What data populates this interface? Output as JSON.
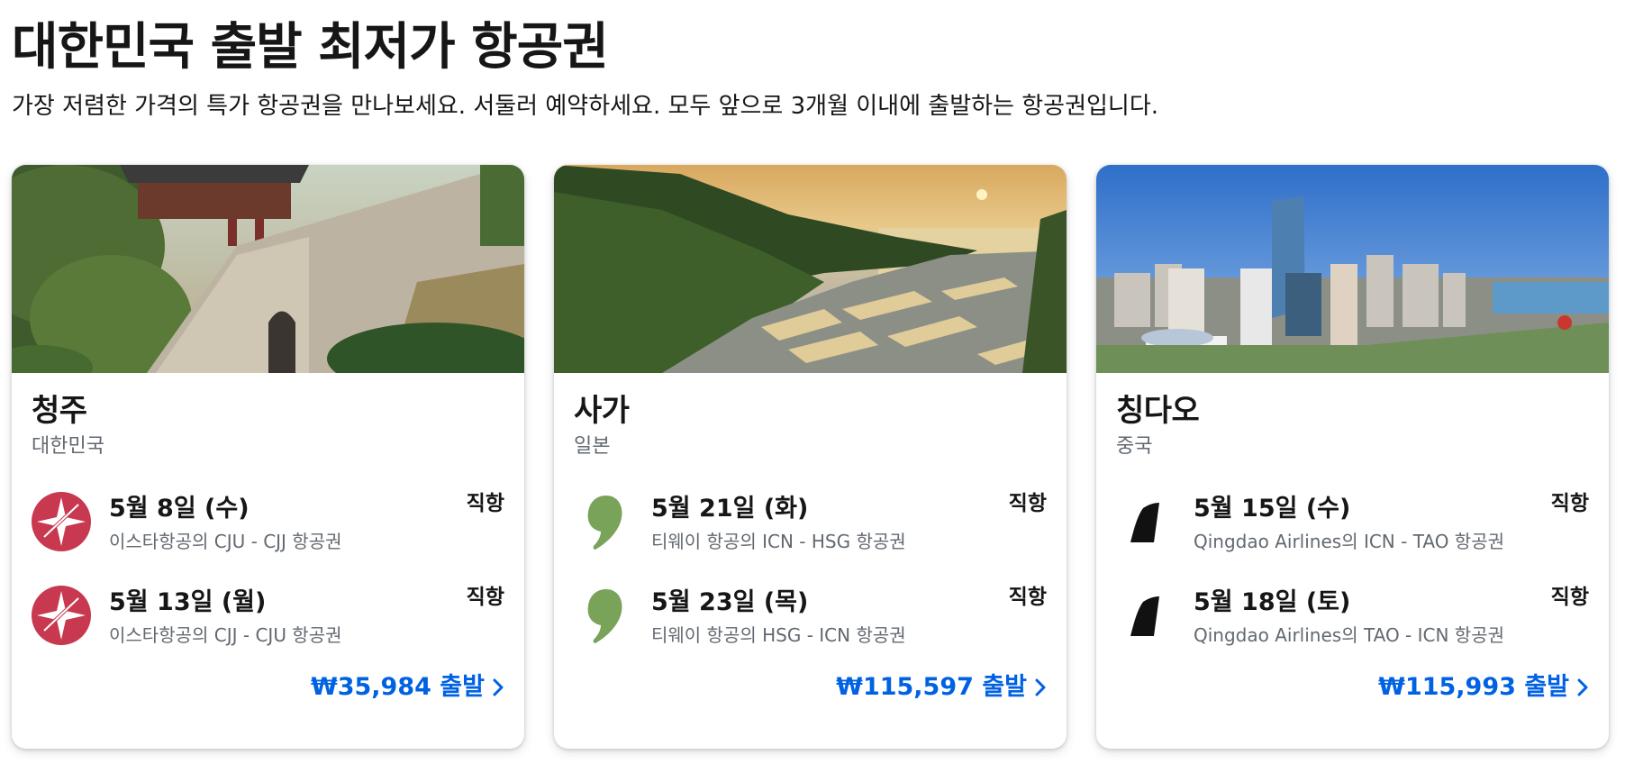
{
  "header": {
    "title": "대한민국 출발 최저가 항공권",
    "subtitle": "가장 저렴한 가격의 특가 항공권을 만나보세요. 서둘러 예약하세요. 모두 앞으로 3개월 이내에 출발하는 항공권입니다."
  },
  "colors": {
    "accent": "#0062e3",
    "eastar": "#c8384f",
    "tway": "#7aa35a",
    "qingdao": "#111111"
  },
  "cards": [
    {
      "city": "청주",
      "country": "대한민국",
      "image": "hwaseong-fortress-wall-photo",
      "flights": [
        {
          "date": "5월 8일 (수)",
          "route": "이스타항공의 CJU - CJJ 항공권",
          "stops": "직항",
          "airline_icon": "eastar-jet-logo-icon"
        },
        {
          "date": "5월 13일 (월)",
          "route": "이스타항공의 CJJ - CJU 항공권",
          "stops": "직항",
          "airline_icon": "eastar-jet-logo-icon"
        }
      ],
      "price": "₩35,984 출발"
    },
    {
      "city": "사가",
      "country": "일본",
      "image": "rice-terrace-sunset-photo",
      "flights": [
        {
          "date": "5월 21일 (화)",
          "route": "티웨이 항공의 ICN - HSG 항공권",
          "stops": "직항",
          "airline_icon": "tway-logo-icon"
        },
        {
          "date": "5월 23일 (목)",
          "route": "티웨이 항공의 HSG - ICN 항공권",
          "stops": "직항",
          "airline_icon": "tway-logo-icon"
        }
      ],
      "price": "₩115,597 출발"
    },
    {
      "city": "칭다오",
      "country": "중국",
      "image": "qingdao-city-skyline-photo",
      "flights": [
        {
          "date": "5월 15일 (수)",
          "route": "Qingdao Airlines의 ICN - TAO 항공권",
          "stops": "직항",
          "airline_icon": "qingdao-airlines-logo-icon"
        },
        {
          "date": "5월 18일 (토)",
          "route": "Qingdao Airlines의 TAO - ICN 항공권",
          "stops": "직항",
          "airline_icon": "qingdao-airlines-logo-icon"
        }
      ],
      "price": "₩115,993 출발"
    }
  ]
}
